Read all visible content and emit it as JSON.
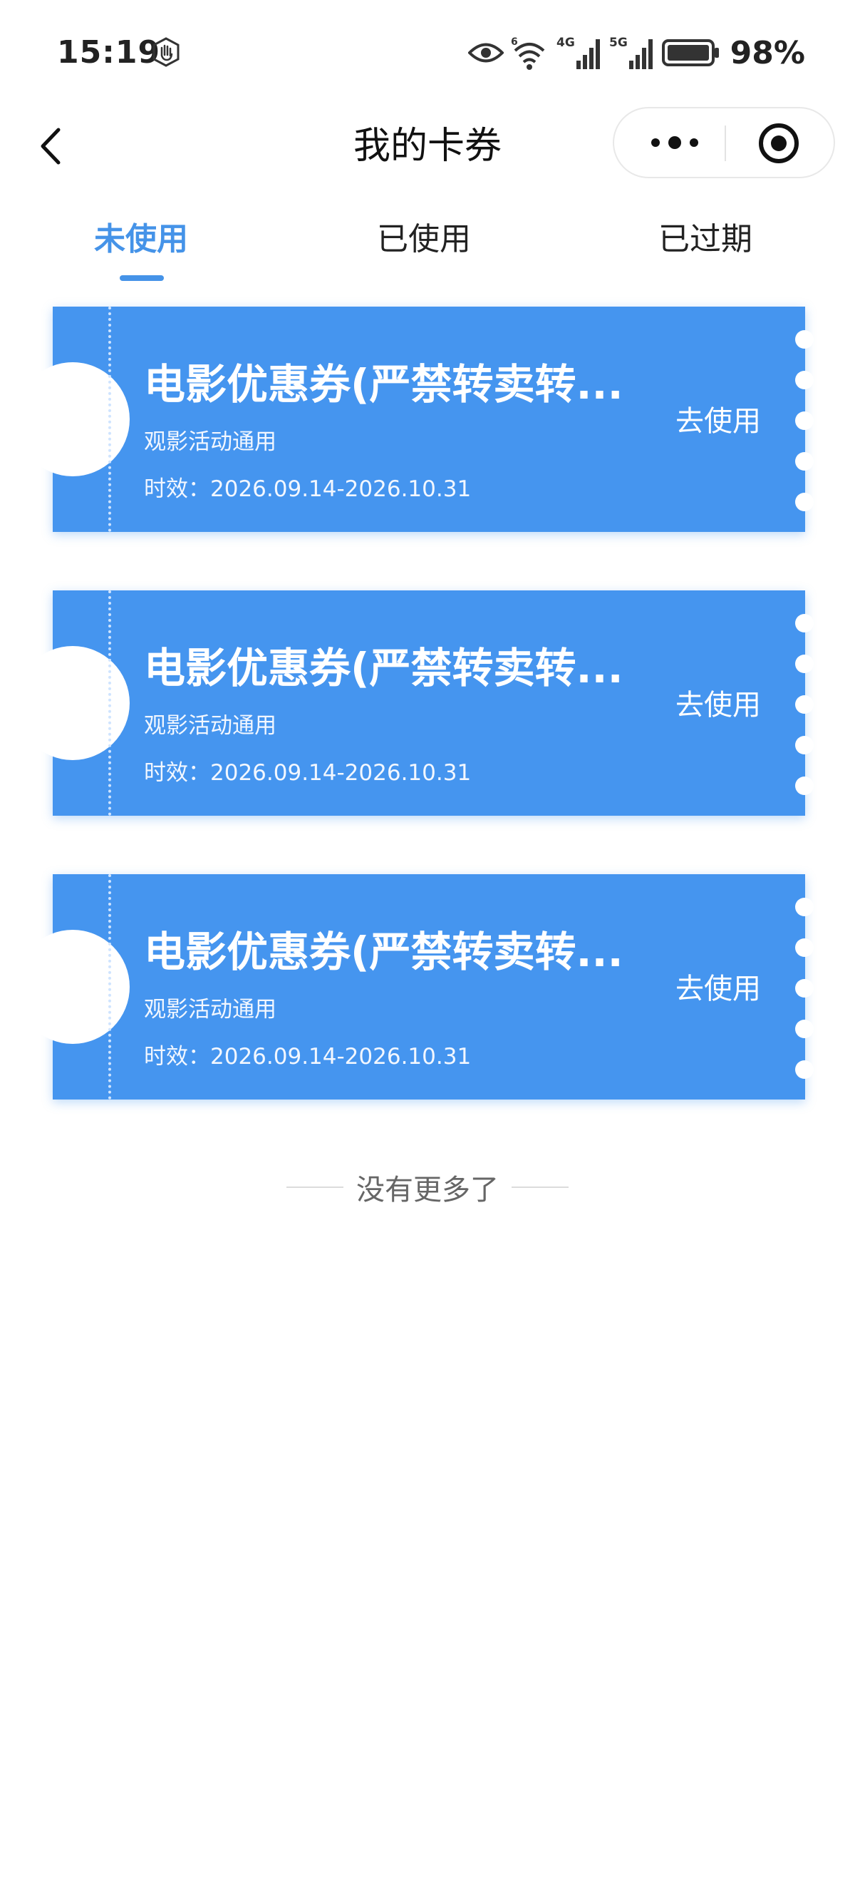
{
  "status_bar": {
    "time": "15:19",
    "battery": "98%",
    "icons": [
      "hand-icon",
      "eye-icon",
      "wifi-icon",
      "signal-4g-icon",
      "signal-5g-icon",
      "battery-icon"
    ]
  },
  "nav": {
    "title": "我的卡券",
    "back_icon": "chevron-left-icon",
    "more_icon": "more-dots-icon",
    "close_icon": "target-icon"
  },
  "tabs": [
    {
      "label": "未使用",
      "active": true
    },
    {
      "label": "已使用",
      "active": false
    },
    {
      "label": "已过期",
      "active": false
    }
  ],
  "coupons": [
    {
      "title": "电影优惠券(严禁转卖转...",
      "subtitle": "观影活动通用",
      "validity": "时效：2026.09.14-2026.10.31",
      "action": "去使用"
    },
    {
      "title": "电影优惠券(严禁转卖转...",
      "subtitle": "观影活动通用",
      "validity": "时效：2026.09.14-2026.10.31",
      "action": "去使用"
    },
    {
      "title": "电影优惠券(严禁转卖转...",
      "subtitle": "观影活动通用",
      "validity": "时效：2026.09.14-2026.10.31",
      "action": "去使用"
    }
  ],
  "footer": {
    "no_more": "没有更多了"
  },
  "colors": {
    "accent": "#4593e8",
    "coupon_bg": "#4595ef",
    "text": "#222222"
  }
}
